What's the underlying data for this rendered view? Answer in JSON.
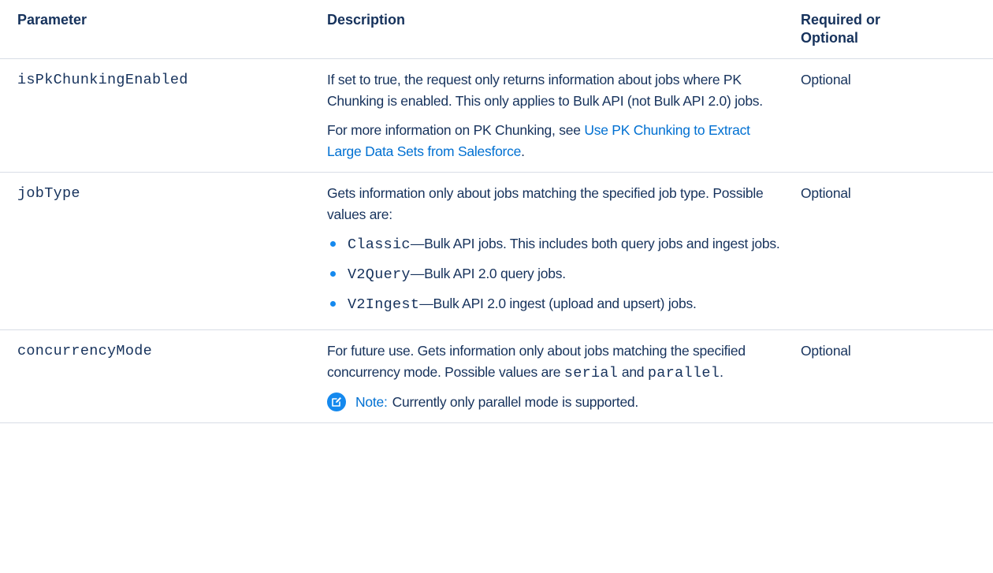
{
  "headers": {
    "parameter": "Parameter",
    "description": "Description",
    "required_line1": "Required or",
    "required_line2": "Optional"
  },
  "rows": [
    {
      "param": "isPkChunkingEnabled",
      "desc_p1": "If set to true, the request only returns information about jobs where PK Chunking is enabled. This only applies to Bulk API (not Bulk API 2.0) jobs.",
      "desc_p2_prefix": "For more information on PK Chunking, see ",
      "desc_p2_link": "Use PK Chunking to Extract Large Data Sets from Salesforce",
      "desc_p2_suffix": ".",
      "required": "Optional"
    },
    {
      "param": "jobType",
      "desc_intro": "Gets information only about jobs matching the specified job type. Possible values are:",
      "bullets": [
        {
          "code": "Classic",
          "text": "—Bulk API jobs. This includes both query jobs and ingest jobs."
        },
        {
          "code": "V2Query",
          "text": "—Bulk API 2.0 query jobs."
        },
        {
          "code": "V2Ingest",
          "text": "—Bulk API 2.0 ingest (upload and upsert) jobs."
        }
      ],
      "required": "Optional"
    },
    {
      "param": "concurrencyMode",
      "desc_text1": "For future use. Gets information only about jobs matching the specified concurrency mode. Possible values are ",
      "desc_code1": "serial",
      "desc_text2": " and ",
      "desc_code2": "parallel",
      "desc_text3": ".",
      "note_label": "Note:",
      "note_text": "Currently only parallel mode is supported.",
      "required": "Optional"
    }
  ],
  "colors": {
    "text": "#16325c",
    "link": "#0070d2",
    "bullet": "#1589ee",
    "border": "#d8dde6"
  },
  "icons": {
    "bullet": "bullet-dot",
    "note": "edit-note-icon"
  }
}
